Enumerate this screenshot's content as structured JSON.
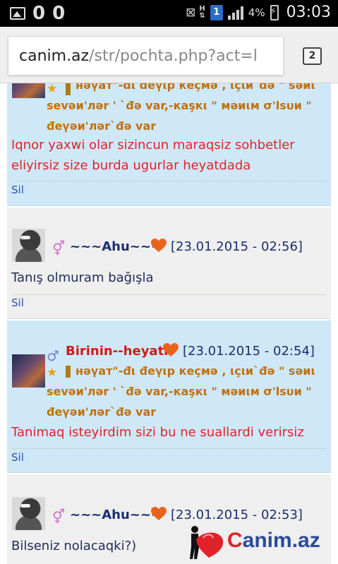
{
  "status_bar": {
    "left_glyphs": [
      "0",
      "0"
    ],
    "network_letter": "H",
    "sim_label": "1",
    "battery_percent": "4%",
    "time": "03:03",
    "icons": [
      "image-icon",
      "mute-icon",
      "data-arrows-icon",
      "sim-icon",
      "signal-icon",
      "battery-charging-icon"
    ]
  },
  "browser": {
    "url_host": "canim.az",
    "url_path": "/str/pochta.php?act=l",
    "tab_count": "2"
  },
  "messages": [
    {
      "type": "partial",
      "status_line1": "нәүат\"-đι đеүιр кеçмә , ιçιи`đә \" ѕәиι",
      "status_line2": "ѕеvәи'ләr ' `đә vаr,-каşкι \" мәиιм σ'lѕυи \"",
      "status_line3": "đеүәи'ләr`đә vаr",
      "text": "Iqnor yaxwi olar sizincun maraqsiz sohbetler eliyirsiz size burda ugurlar heyatdada",
      "action": "Sil"
    },
    {
      "type": "gray",
      "nickname": "~~~Ahu~~~",
      "gender": "female",
      "date": "[23.01.2015 - 02:56]",
      "text": "Tanış olmuram bağışla",
      "action": "Sil"
    },
    {
      "type": "blue",
      "nickname": "Birinin--heyatii",
      "gender": "male",
      "date": "[23.01.2015 - 02:54]",
      "status_line1": "нәүат\"-đι đеүιр кеçмә , ιçιи`đә \" ѕәиι",
      "status_line2": "ѕеvәи'ләr ' `đә vаr,-каşкι \" мәиιм σ'lѕυи \"",
      "status_line3": "đеүәи'ләr`đә vаr",
      "text": "Tanimaq isteyirdim sizi bu ne suallardi verirsiz",
      "action": "Sil"
    },
    {
      "type": "gray",
      "nickname": "~~~Ahu~~~",
      "gender": "female",
      "date": "[23.01.2015 - 02:53]",
      "text": "Bilseniz nolacaqki?)"
    }
  ],
  "logo": {
    "text_c": "C",
    "text_rest": "anim.az"
  },
  "colors": {
    "blue_bg": "#cfe8f8",
    "gray_bg": "#efefef",
    "red_text": "#e0232a",
    "nick_blue": "#1c2e70",
    "status_orange": "#c07010",
    "link_blue": "#2d50a0"
  }
}
